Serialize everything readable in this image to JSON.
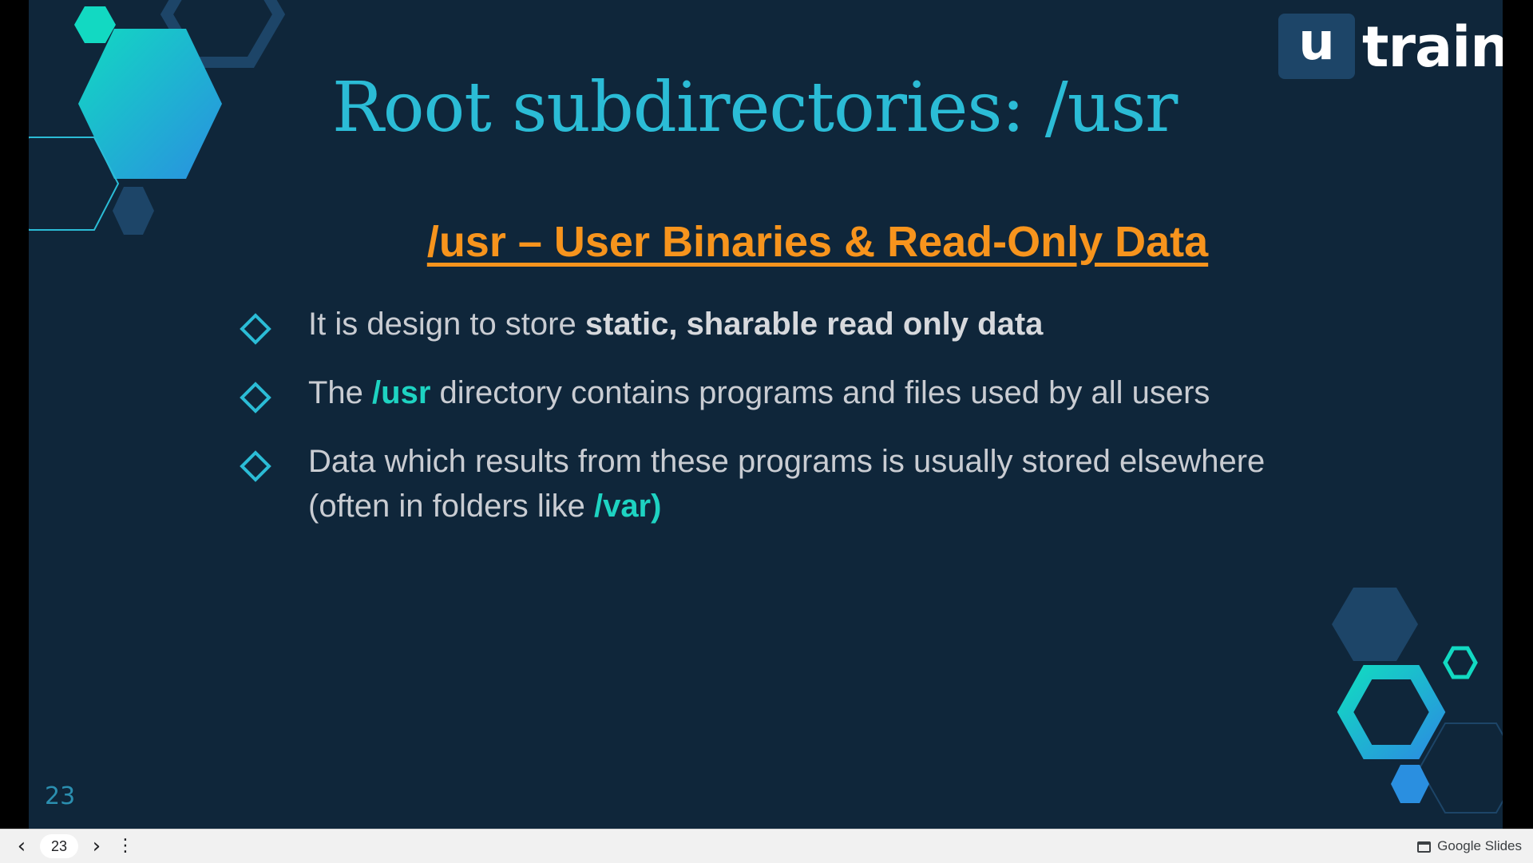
{
  "logo": {
    "box_letter": "u",
    "word": "train"
  },
  "title": "Root subdirectories: /usr",
  "subtitle": "/usr – User Binaries & Read-Only Data",
  "bullets": [
    {
      "pre": "It is design to store ",
      "bold": "static, sharable read only data"
    },
    {
      "pre": "The ",
      "hl": "/usr",
      "post": " directory contains programs and files used by all users"
    },
    {
      "line1": "Data which results from these programs is usually stored elsewhere",
      "pre": "(often in folders like ",
      "hl": "/var)"
    }
  ],
  "slide_number": "23",
  "toolbar": {
    "prev_icon": "chevron-left-icon",
    "page_current": "23",
    "next_icon": "chevron-right-icon",
    "more_icon": "more-vert-icon",
    "brand": "Google Slides"
  },
  "colors": {
    "background": "#0f263a",
    "title": "#2bbcd6",
    "subtitle": "#f7941d",
    "highlight": "#1ed3c2",
    "body_text": "#c9ccd2"
  }
}
